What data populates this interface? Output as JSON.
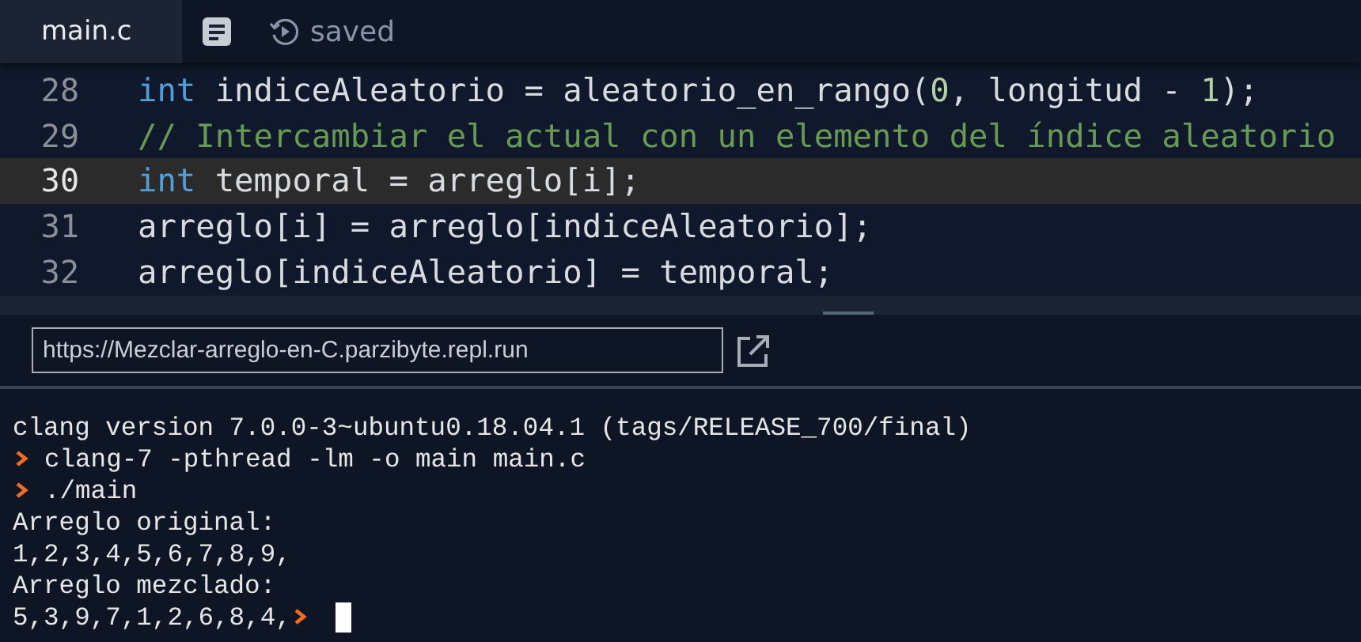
{
  "tabs": [
    {
      "label": "main.c",
      "selected": true
    }
  ],
  "status": {
    "label": "saved"
  },
  "editor": {
    "lines": [
      {
        "number": "28",
        "highlighted": false,
        "tokens": [
          {
            "text": "int",
            "kind": "keyword"
          },
          {
            "text": " indiceAleatorio = aleatorio_en_rango(",
            "kind": "plain"
          },
          {
            "text": "0",
            "kind": "number"
          },
          {
            "text": ", longitud - ",
            "kind": "plain"
          },
          {
            "text": "1",
            "kind": "number"
          },
          {
            "text": ");",
            "kind": "plain"
          }
        ]
      },
      {
        "number": "29",
        "highlighted": false,
        "tokens": [
          {
            "text": "// Intercambiar el actual con un elemento del índice aleatorio",
            "kind": "comment"
          }
        ]
      },
      {
        "number": "30",
        "highlighted": true,
        "tokens": [
          {
            "text": "int",
            "kind": "keyword"
          },
          {
            "text": " temporal = arreglo[i];",
            "kind": "plain"
          }
        ]
      },
      {
        "number": "31",
        "highlighted": false,
        "tokens": [
          {
            "text": "arreglo[i] = arreglo[indiceAleatorio];",
            "kind": "plain"
          }
        ]
      },
      {
        "number": "32",
        "highlighted": false,
        "tokens": [
          {
            "text": "arreglo[indiceAleatorio] = temporal;",
            "kind": "plain"
          }
        ]
      }
    ]
  },
  "url": {
    "value": "https://Mezclar-arreglo-en-C.parzibyte.repl.run"
  },
  "terminal": {
    "lines": [
      {
        "kind": "output",
        "text": "clang version 7.0.0-3~ubuntu0.18.04.1 (tags/RELEASE_700/final)"
      },
      {
        "kind": "command",
        "text": "clang-7 -pthread -lm -o main main.c"
      },
      {
        "kind": "command",
        "text": "./main"
      },
      {
        "kind": "output",
        "text": "Arreglo original:"
      },
      {
        "kind": "output",
        "text": "1,2,3,4,5,6,7,8,9,"
      },
      {
        "kind": "output",
        "text": "Arreglo mezclado:"
      },
      {
        "kind": "cursor",
        "text": "5,3,9,7,1,2,6,8,4,"
      }
    ]
  }
}
